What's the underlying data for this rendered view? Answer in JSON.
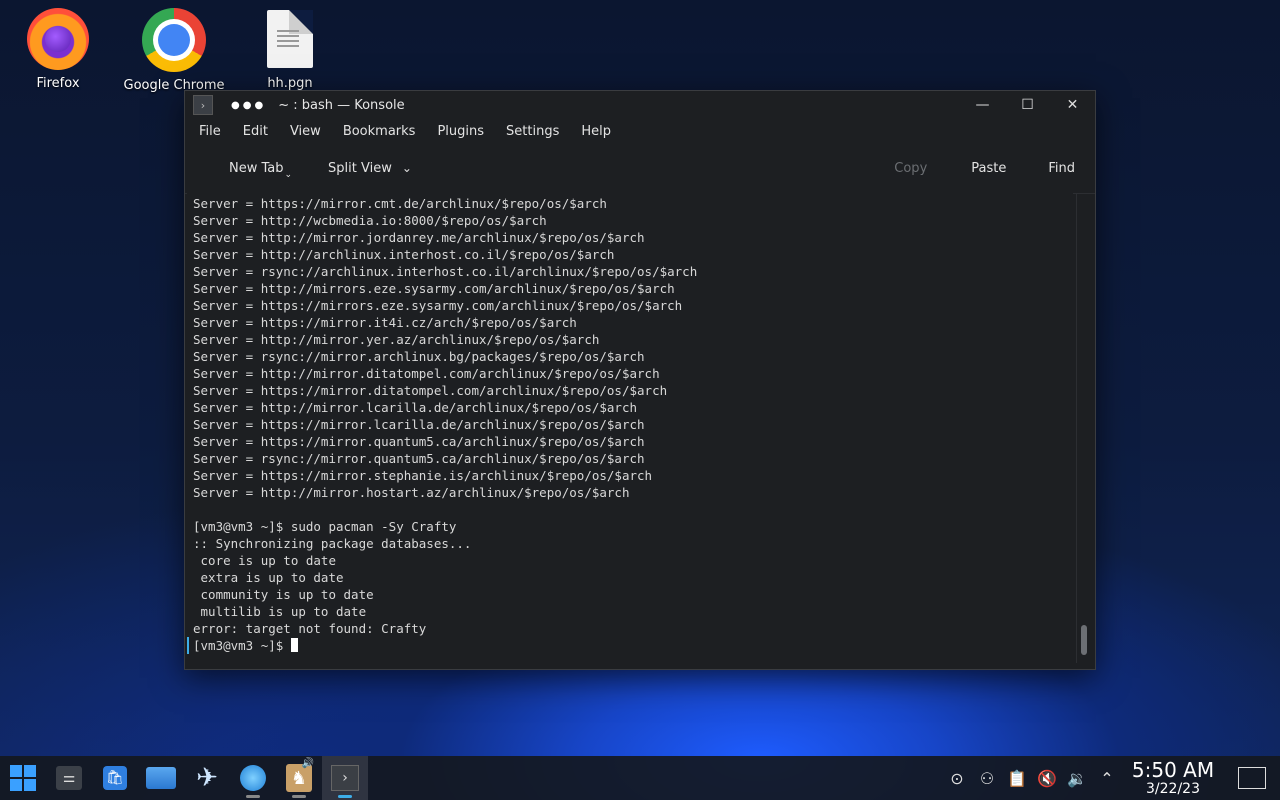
{
  "desktop": {
    "icons": [
      {
        "label": "Firefox",
        "icon": "firefox-icon"
      },
      {
        "label": "Google Chrome",
        "icon": "chrome-icon"
      },
      {
        "label": "hh.pgn",
        "icon": "file-icon"
      }
    ]
  },
  "window": {
    "title": "~ : bash — Konsole",
    "menu": [
      "File",
      "Edit",
      "View",
      "Bookmarks",
      "Plugins",
      "Settings",
      "Help"
    ],
    "toolbar": {
      "new_tab": "New Tab",
      "split_view": "Split View",
      "copy": "Copy",
      "paste": "Paste",
      "find": "Find"
    },
    "terminal_lines": [
      "Server = https://mirror.cmt.de/archlinux/$repo/os/$arch",
      "Server = http://wcbmedia.io:8000/$repo/os/$arch",
      "Server = http://mirror.jordanrey.me/archlinux/$repo/os/$arch",
      "Server = http://archlinux.interhost.co.il/$repo/os/$arch",
      "Server = rsync://archlinux.interhost.co.il/archlinux/$repo/os/$arch",
      "Server = http://mirrors.eze.sysarmy.com/archlinux/$repo/os/$arch",
      "Server = https://mirrors.eze.sysarmy.com/archlinux/$repo/os/$arch",
      "Server = https://mirror.it4i.cz/arch/$repo/os/$arch",
      "Server = http://mirror.yer.az/archlinux/$repo/os/$arch",
      "Server = rsync://mirror.archlinux.bg/packages/$repo/os/$arch",
      "Server = http://mirror.ditatompel.com/archlinux/$repo/os/$arch",
      "Server = https://mirror.ditatompel.com/archlinux/$repo/os/$arch",
      "Server = http://mirror.lcarilla.de/archlinux/$repo/os/$arch",
      "Server = https://mirror.lcarilla.de/archlinux/$repo/os/$arch",
      "Server = https://mirror.quantum5.ca/archlinux/$repo/os/$arch",
      "Server = rsync://mirror.quantum5.ca/archlinux/$repo/os/$arch",
      "Server = https://mirror.stephanie.is/archlinux/$repo/os/$arch",
      "Server = http://mirror.hostart.az/archlinux/$repo/os/$arch",
      "",
      "[vm3@vm3 ~]$ sudo pacman -Sy Crafty",
      ":: Synchronizing package databases...",
      " core is up to date",
      " extra is up to date",
      " community is up to date",
      " multilib is up to date",
      "error: target not found: Crafty"
    ],
    "prompt": "[vm3@vm3 ~]$ "
  },
  "taskbar": {
    "apps": [
      "start-menu-icon",
      "system-settings-icon",
      "discover-store-icon",
      "file-manager-icon",
      "network-app-icon",
      "browser-icon",
      "chess-app-icon",
      "konsole-icon"
    ],
    "clock": {
      "time": "5:50 AM",
      "date": "3/22/23"
    }
  }
}
